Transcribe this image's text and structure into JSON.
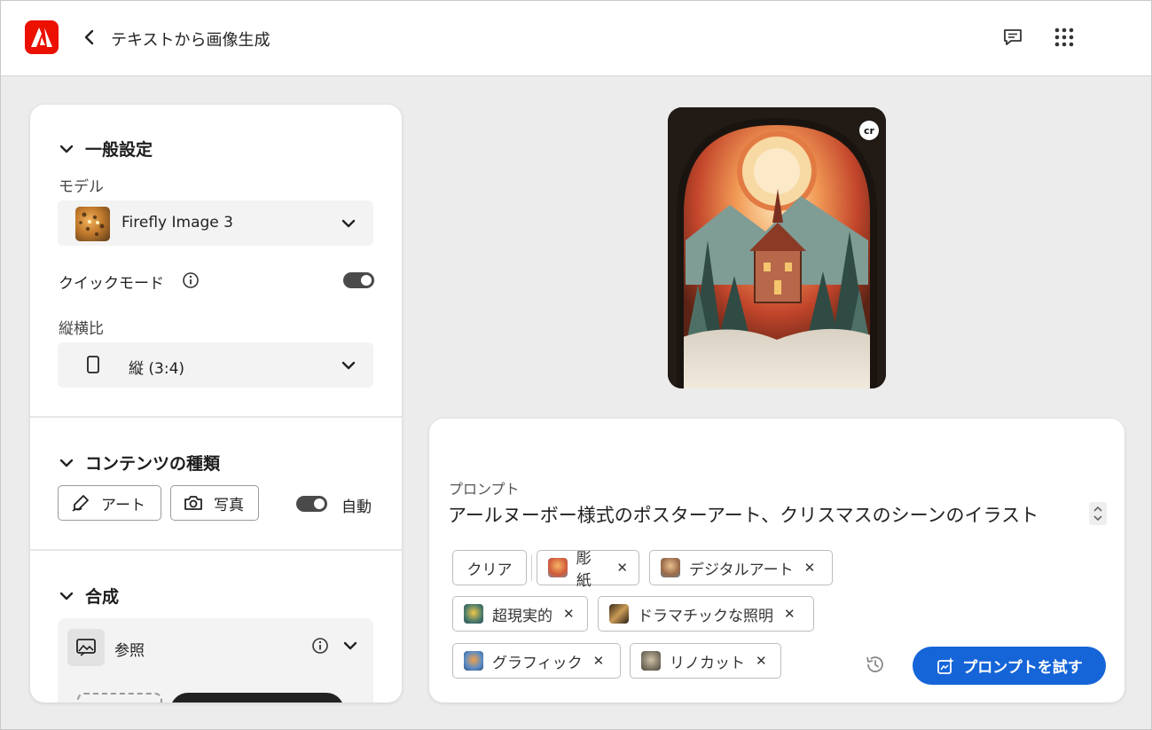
{
  "header": {
    "title": "テキストから画像生成"
  },
  "colors": {
    "brand": "#eb1000",
    "accent": "#1565d8"
  },
  "general": {
    "title": "一般設定",
    "model_label": "モデル",
    "model_value": "Firefly Image 3",
    "quick_mode_label": "クイックモード",
    "aspect_label": "縦横比",
    "aspect_value": "縦 (3:4)"
  },
  "content_type": {
    "title": "コンテンツの種類",
    "art_label": "アート",
    "photo_label": "写真",
    "auto_label": "自動"
  },
  "composition": {
    "title": "合成",
    "reference_label": "参照"
  },
  "prompt": {
    "label": "プロンプト",
    "text": "アールヌーボー様式のポスターアート、クリスマスのシーンのイラスト",
    "clear_label": "クリア",
    "chips": [
      {
        "label": "彫紙"
      },
      {
        "label": "デジタルアート"
      },
      {
        "label": "超現実的"
      },
      {
        "label": "ドラマチックな照明"
      },
      {
        "label": "グラフィック"
      },
      {
        "label": "リノカット"
      }
    ],
    "try_label": "プロンプトを試す"
  },
  "preview": {
    "badge": "cr"
  }
}
